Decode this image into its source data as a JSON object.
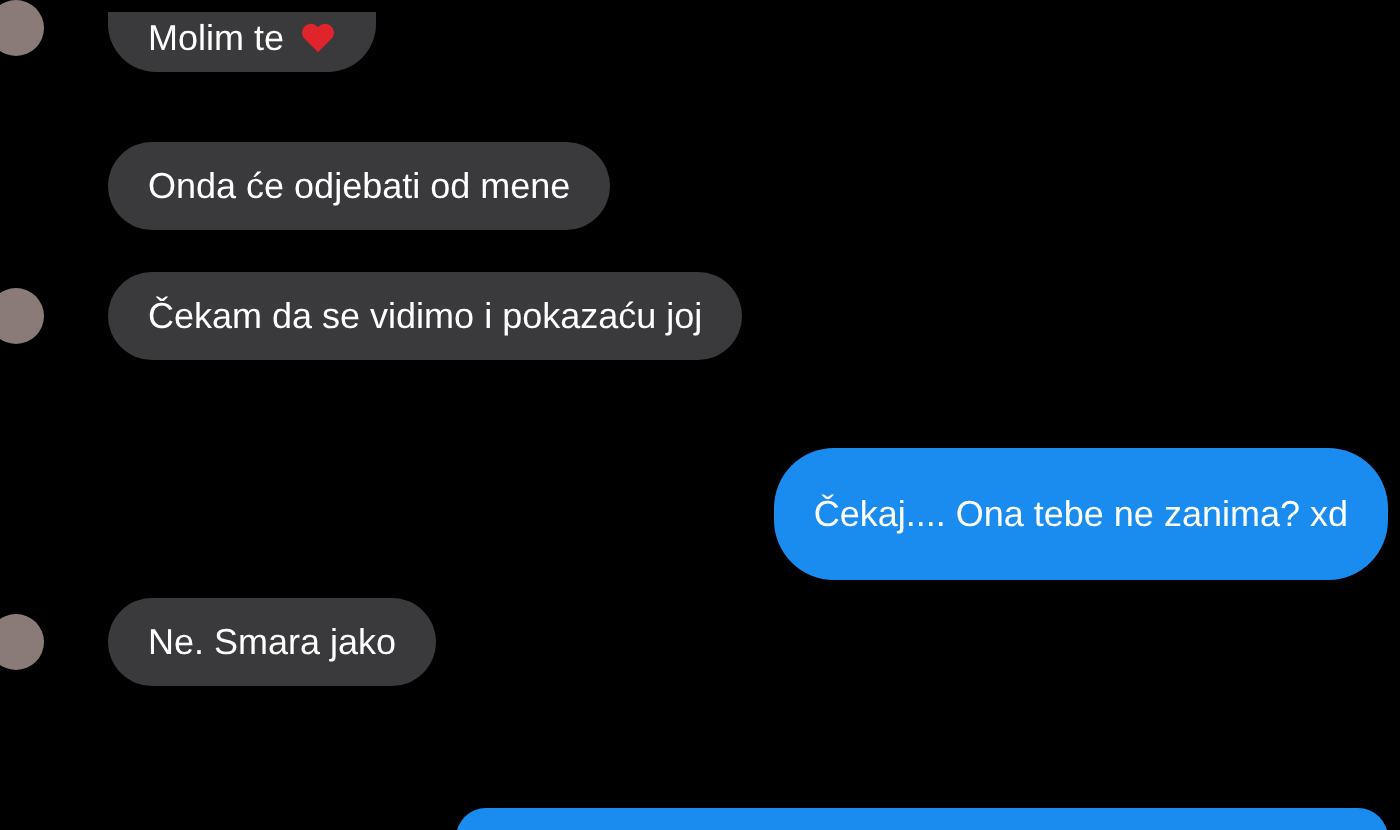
{
  "messages": [
    {
      "kind": "received",
      "text": "Molim te",
      "heart": true,
      "avatar": true
    },
    {
      "kind": "received",
      "text": "Onda će odjebati od mene",
      "heart": false,
      "avatar": false
    },
    {
      "kind": "received",
      "text": "Čekam da se vidimo i pokazaću joj",
      "heart": false,
      "avatar": true
    },
    {
      "kind": "sent",
      "text": "Čekaj.... Ona tebe ne zanima? xd",
      "heart": false
    },
    {
      "kind": "received",
      "text": "Ne. Smara jako",
      "heart": false,
      "avatar": true
    },
    {
      "kind": "sent"
    }
  ]
}
